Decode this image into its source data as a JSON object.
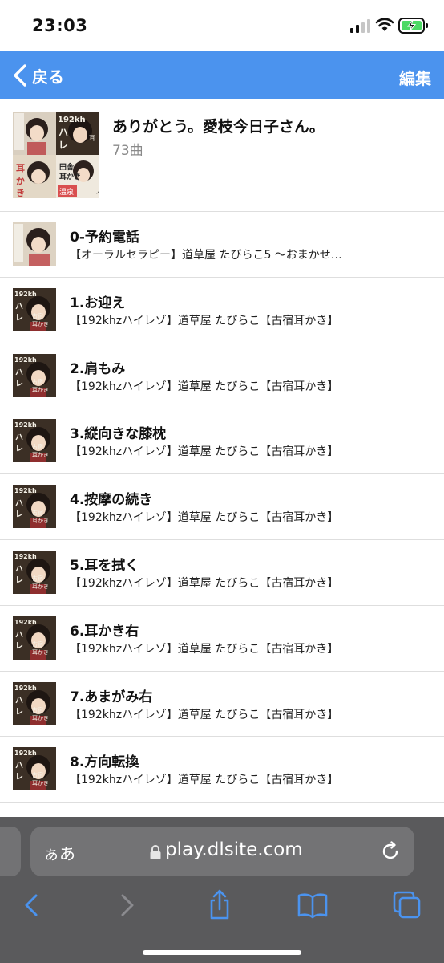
{
  "status_bar": {
    "time": "23:03",
    "icons": [
      "cellular-signal-icon",
      "wifi-icon",
      "battery-charging-icon"
    ],
    "battery_color": "#4cd964"
  },
  "nav": {
    "back_label": "戻る",
    "edit_label": "編集",
    "background_color": "#4b93ee"
  },
  "album": {
    "title": "ありがとう。愛枝今日子さん。",
    "count": "73曲",
    "cover_tiles": [
      "",
      "192kh\nハイ\nレゾ",
      "耳かき",
      "田舎\n耳かき",
      "温泉",
      "二人で\n保湿"
    ]
  },
  "tracks": [
    {
      "title": "0-予約電話",
      "subtitle": "【オーラルセラピー】道草屋 たびらこ5 〜おまかせ…",
      "thumb": "plain"
    },
    {
      "title": "1.お迎え",
      "subtitle": "【192khzハイレゾ】道草屋 たびらこ【古宿耳かき】",
      "thumb": "hires"
    },
    {
      "title": "2.肩もみ",
      "subtitle": "【192khzハイレゾ】道草屋 たびらこ【古宿耳かき】",
      "thumb": "hires"
    },
    {
      "title": "3.縦向きな膝枕",
      "subtitle": "【192khzハイレゾ】道草屋 たびらこ【古宿耳かき】",
      "thumb": "hires"
    },
    {
      "title": "4.按摩の続き",
      "subtitle": "【192khzハイレゾ】道草屋 たびらこ【古宿耳かき】",
      "thumb": "hires"
    },
    {
      "title": "5.耳を拭く",
      "subtitle": "【192khzハイレゾ】道草屋 たびらこ【古宿耳かき】",
      "thumb": "hires"
    },
    {
      "title": "6.耳かき右",
      "subtitle": "【192khzハイレゾ】道草屋 たびらこ【古宿耳かき】",
      "thumb": "hires"
    },
    {
      "title": "7.あまがみ右",
      "subtitle": "【192khzハイレゾ】道草屋 たびらこ【古宿耳かき】",
      "thumb": "hires"
    },
    {
      "title": "8.方向転換",
      "subtitle": "【192khzハイレゾ】道草屋 たびらこ【古宿耳かき】",
      "thumb": "hires"
    }
  ],
  "thumb_text": {
    "hires_badge": "192kh",
    "hires_side": "ハイレゾ",
    "hires_label": "古宿\n耳かき"
  },
  "safari": {
    "text_size_label": "ぁあ",
    "url": "play.dlsite.com",
    "toolbar": [
      "back-icon",
      "forward-icon",
      "share-icon",
      "bookmarks-icon",
      "tabs-icon"
    ],
    "accent_color": "#4b93ee"
  }
}
